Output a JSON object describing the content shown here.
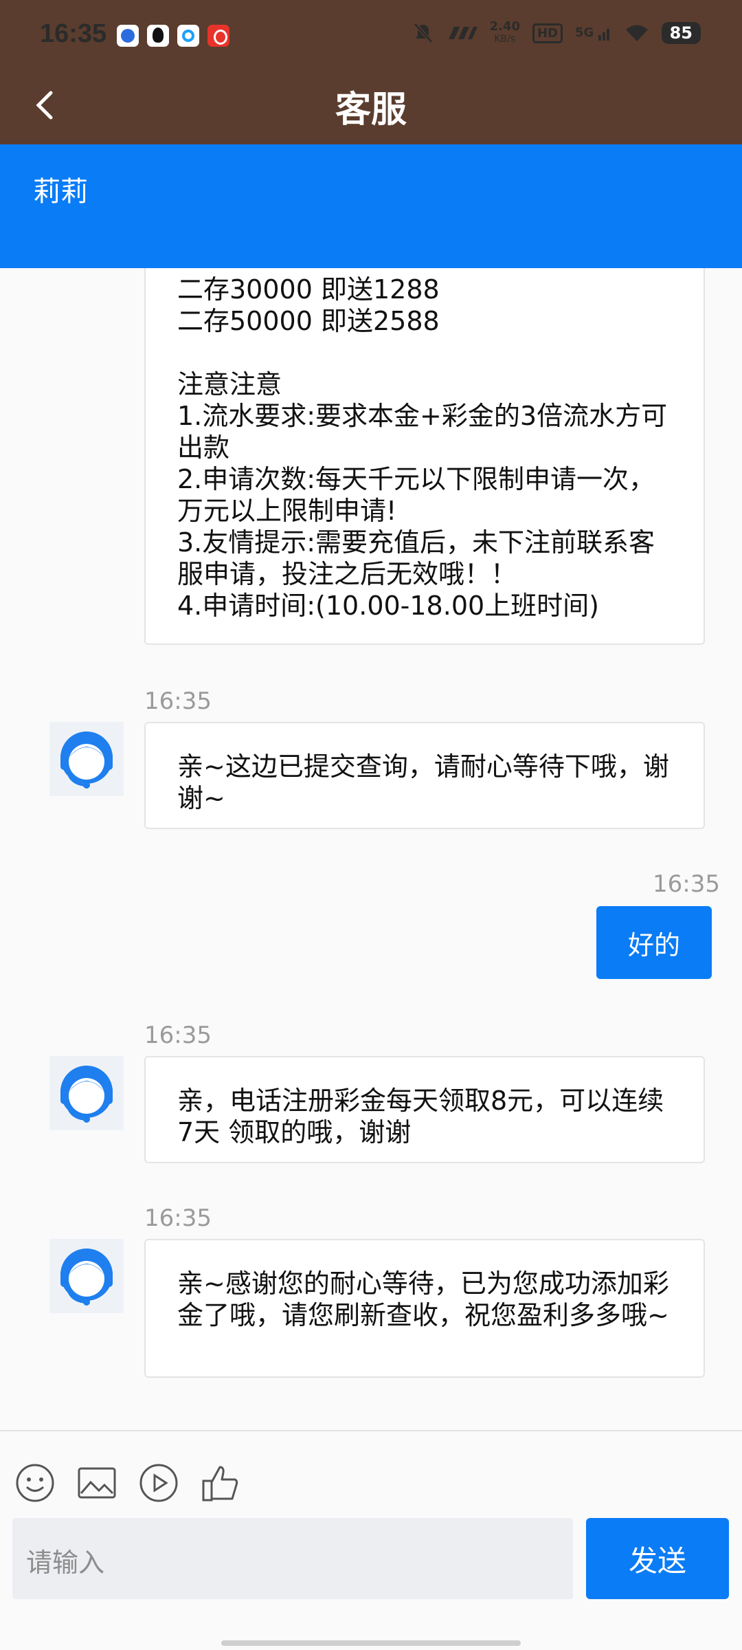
{
  "status_bar": {
    "time": "16:35",
    "net_speed_value": "2.40",
    "net_speed_unit": "KB/s",
    "hd": "HD",
    "signal": "5G",
    "battery": "85"
  },
  "header": {
    "title": "客服"
  },
  "agent_bar": {
    "name": "莉莉"
  },
  "messages": [
    {
      "text": "二存30000 即送1288\n二存50000 即送2588\n\n注意注意\n1.流水要求:要求本金+彩金的3倍流水方可出款\n2.申请次数:每天千元以下限制申请一次，万元以上限制申请!\n3.友情提示:需要充值后，未下注前联系客服申请，投注之后无效哦！！\n4.申请时间:(10.00-18.00上班时间)"
    },
    {
      "time": "16:35",
      "text": "亲~这边已提交查询，请耐心等待下哦，谢谢~"
    },
    {
      "time": "16:35",
      "text": "好的"
    },
    {
      "time": "16:35",
      "text": "亲，电话注册彩金每天领取8元，可以连续 7天 领取的哦，谢谢"
    },
    {
      "time": "16:35",
      "text": "亲~感谢您的耐心等待，已为您成功添加彩金了哦，请您刷新查收，祝您盈利多多哦~"
    }
  ],
  "input": {
    "placeholder": "请输入",
    "send_label": "发送"
  },
  "colors": {
    "header_bg": "#5a3d2e",
    "accent": "#0a7cf6"
  }
}
